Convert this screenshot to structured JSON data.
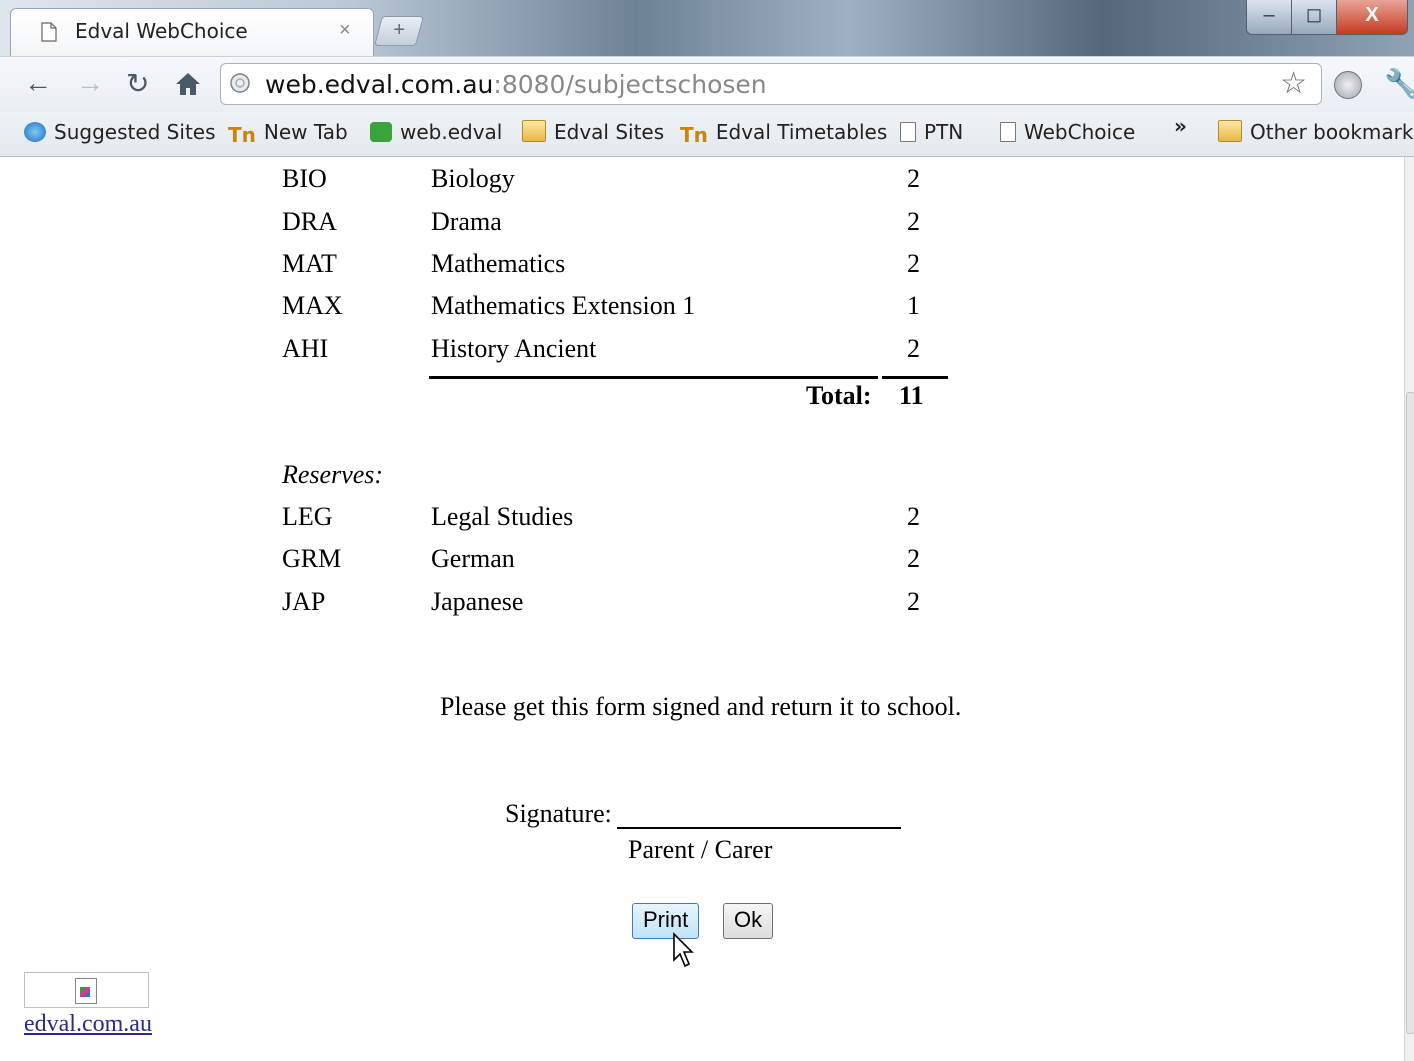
{
  "browser": {
    "tab_title": "Edval WebChoice",
    "tab_close": "×",
    "new_tab_symbol": "+",
    "url_host": "web.edval.com.au",
    "url_path": ":8080/subjectschosen",
    "window_buttons": {
      "minimize": "–",
      "maximize": "◻",
      "close": "X"
    },
    "bookmarks": [
      {
        "label": "Suggested Sites",
        "icon": "ie-icon"
      },
      {
        "label": "New Tab",
        "icon": "tn-icon"
      },
      {
        "label": "web.edval",
        "icon": "edval-icon"
      },
      {
        "label": "Edval Sites",
        "icon": "folder-icon"
      },
      {
        "label": "Edval Timetables",
        "icon": "tn-icon"
      },
      {
        "label": "PTN",
        "icon": "page-icon"
      },
      {
        "label": "WebChoice",
        "icon": "page-icon"
      }
    ],
    "bookmarks_overflow": "»",
    "other_bookmarks": "Other bookmarks"
  },
  "subjects": [
    {
      "code": "BIO",
      "name": "Biology",
      "units": "2"
    },
    {
      "code": "DRA",
      "name": "Drama",
      "units": "2"
    },
    {
      "code": "MAT",
      "name": "Mathematics",
      "units": "2"
    },
    {
      "code": "MAX",
      "name": "Mathematics Extension 1",
      "units": "1"
    },
    {
      "code": "AHI",
      "name": "History Ancient",
      "units": "2"
    }
  ],
  "total": {
    "label": "Total:",
    "value": "11"
  },
  "reserves": {
    "label": "Reserves:",
    "items": [
      {
        "code": "LEG",
        "name": "Legal Studies",
        "units": "2"
      },
      {
        "code": "GRM",
        "name": "German",
        "units": "2"
      },
      {
        "code": "JAP",
        "name": "Japanese",
        "units": "2"
      }
    ]
  },
  "notice": "Please get this form signed and return it to school.",
  "signature": {
    "label": "Signature:",
    "caption": "Parent / Carer"
  },
  "buttons": {
    "print": "Print",
    "ok": "Ok"
  },
  "footer": {
    "link": "edval.com.au"
  }
}
